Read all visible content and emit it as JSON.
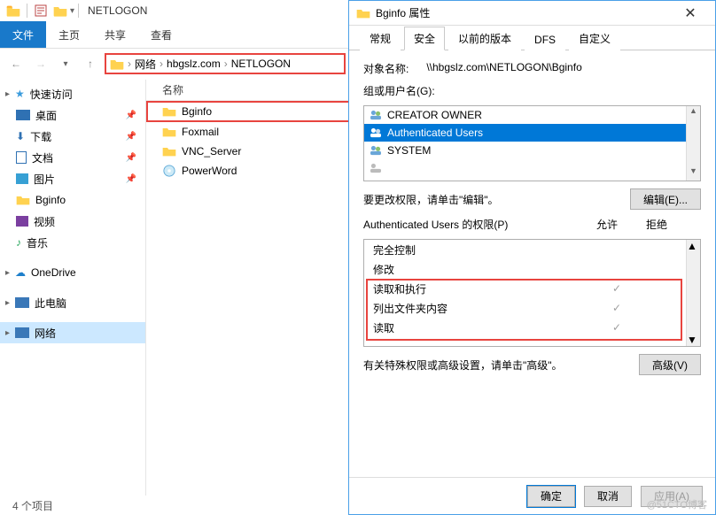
{
  "explorer": {
    "title": "NETLOGON",
    "ribbon": {
      "file": "文件",
      "tabs": [
        "主页",
        "共享",
        "查看"
      ]
    },
    "breadcrumb": [
      "网络",
      "hbgslz.com",
      "NETLOGON"
    ],
    "name_header": "名称",
    "items": [
      {
        "label": "Bginfo",
        "type": "folder",
        "selected": true
      },
      {
        "label": "Foxmail",
        "type": "folder"
      },
      {
        "label": "VNC_Server",
        "type": "folder"
      },
      {
        "label": "PowerWord",
        "type": "app"
      }
    ],
    "sidebar": {
      "quick": {
        "label": "快速访问",
        "items": [
          {
            "label": "桌面",
            "pin": true,
            "icon": "desktop"
          },
          {
            "label": "下载",
            "pin": true,
            "icon": "downloads"
          },
          {
            "label": "文档",
            "pin": true,
            "icon": "documents"
          },
          {
            "label": "图片",
            "pin": true,
            "icon": "pictures"
          },
          {
            "label": "Bginfo",
            "pin": false,
            "icon": "folder"
          },
          {
            "label": "视频",
            "pin": false,
            "icon": "videos"
          },
          {
            "label": "音乐",
            "pin": false,
            "icon": "music"
          }
        ]
      },
      "onedrive": "OneDrive",
      "thispc": "此电脑",
      "network": "网络"
    },
    "status": "4 个项目"
  },
  "props": {
    "title": "Bginfo 属性",
    "tabs": [
      "常规",
      "安全",
      "以前的版本",
      "DFS",
      "自定义"
    ],
    "active_tab": 1,
    "object_name_label": "对象名称:",
    "object_name": "\\\\hbgslz.com\\NETLOGON\\Bginfo",
    "group_label": "组或用户名(G):",
    "users": [
      "CREATOR OWNER",
      "Authenticated Users",
      "SYSTEM"
    ],
    "selected_user_index": 1,
    "edit_hint": "要更改权限，请单击\"编辑\"。",
    "edit_btn": "编辑(E)...",
    "perm_header": "Authenticated Users 的权限(P)",
    "perm_cols": [
      "允许",
      "拒绝"
    ],
    "perm_rows": [
      {
        "label": "完全控制",
        "allow": false
      },
      {
        "label": "修改",
        "allow": false
      },
      {
        "label": "读取和执行",
        "allow": true
      },
      {
        "label": "列出文件夹内容",
        "allow": true
      },
      {
        "label": "读取",
        "allow": true
      }
    ],
    "advanced_hint": "有关特殊权限或高级设置，请单击\"高级\"。",
    "advanced_btn": "高级(V)",
    "buttons": [
      "确定",
      "取消",
      "应用(A)"
    ]
  },
  "watermark": "@51CTO博客"
}
